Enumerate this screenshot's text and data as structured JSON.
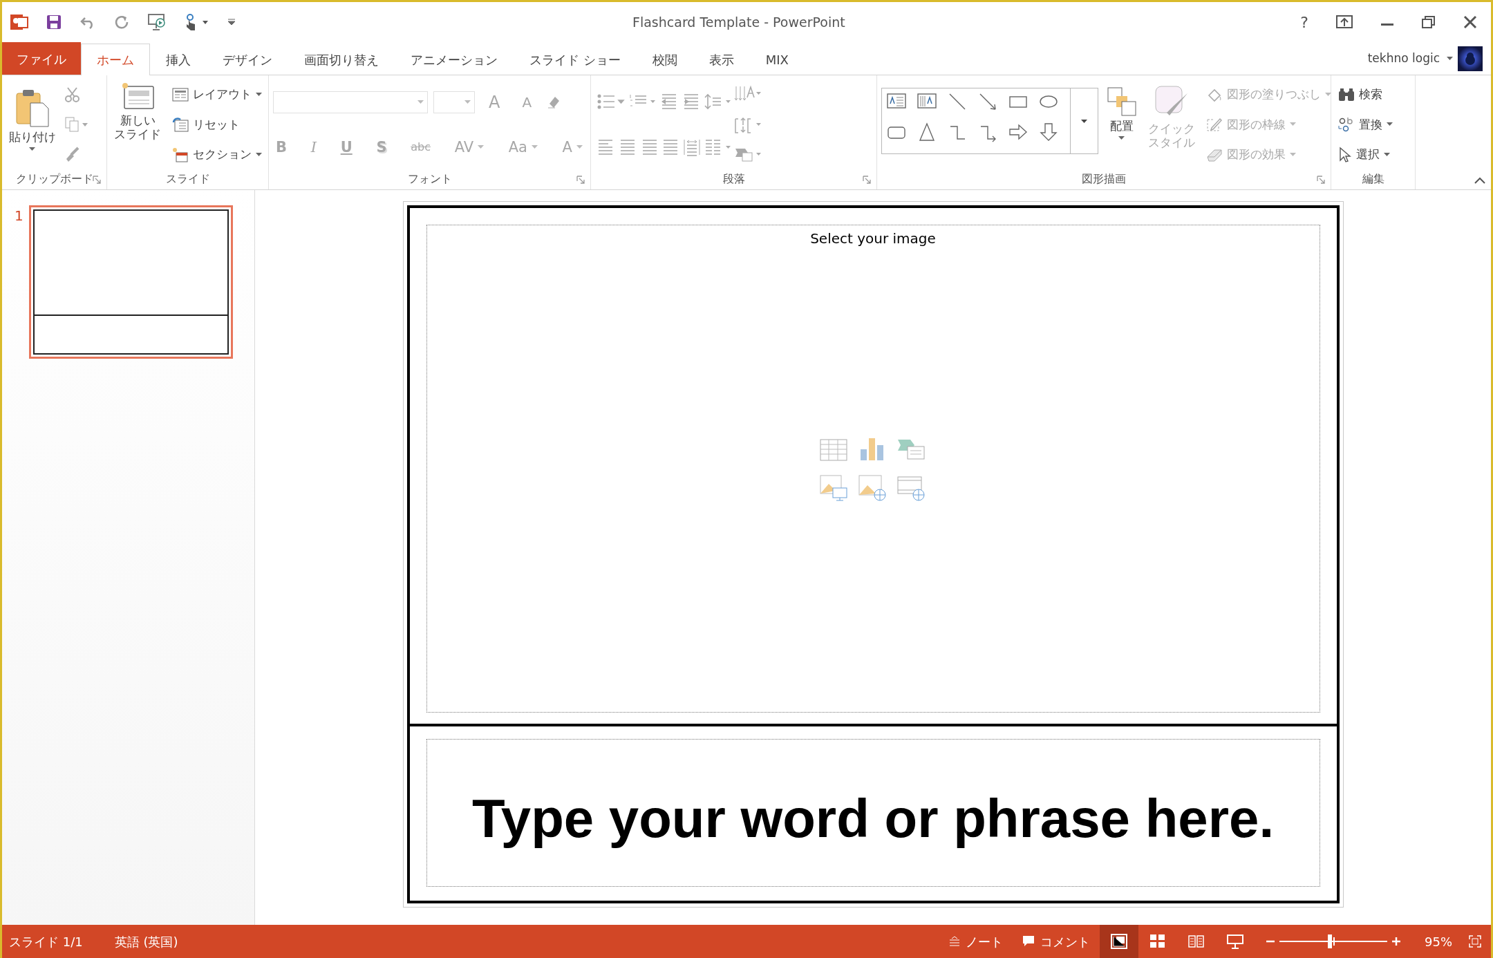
{
  "window": {
    "title": "Flashcard Template - PowerPoint",
    "help": "?"
  },
  "tabs": [
    {
      "label": "ファイル",
      "kind": "file",
      "selected": false
    },
    {
      "label": "ホーム",
      "kind": "tab",
      "selected": true
    },
    {
      "label": "挿入",
      "kind": "tab",
      "selected": false
    },
    {
      "label": "デザイン",
      "kind": "tab",
      "selected": false
    },
    {
      "label": "画面切り替え",
      "kind": "tab",
      "selected": false
    },
    {
      "label": "アニメーション",
      "kind": "tab",
      "selected": false
    },
    {
      "label": "スライド ショー",
      "kind": "tab",
      "selected": false
    },
    {
      "label": "校閲",
      "kind": "tab",
      "selected": false
    },
    {
      "label": "表示",
      "kind": "tab",
      "selected": false
    },
    {
      "label": "MIX",
      "kind": "tab",
      "selected": false
    }
  ],
  "account": {
    "name": "tekhno logic"
  },
  "ribbon": {
    "clipboard": {
      "title": "クリップボード",
      "paste": "貼り付け",
      "tools_disabled": true
    },
    "slides": {
      "title": "スライド",
      "new_slide": [
        "新しい",
        "スライド"
      ],
      "commands": [
        {
          "label": "レイアウト",
          "dropdown": true
        },
        {
          "label": "リセット",
          "dropdown": false
        },
        {
          "label": "セクション",
          "dropdown": true
        }
      ]
    },
    "font": {
      "title": "フォント",
      "disabled": true,
      "size_buttons": [
        "A",
        "A"
      ],
      "format_buttons": [
        "B",
        "I",
        "U",
        "S",
        "abc",
        "AV",
        "Aa",
        "A"
      ]
    },
    "paragraph": {
      "title": "段落",
      "disabled": true
    },
    "drawing": {
      "title": "図形描画",
      "arrange": "配置",
      "quick_styles": {
        "label": [
          "クイック",
          "スタイル"
        ],
        "disabled": true
      },
      "commands": [
        {
          "label": "図形の塗りつぶし",
          "disabled": true
        },
        {
          "label": "図形の枠線",
          "disabled": true
        },
        {
          "label": "図形の効果",
          "disabled": true
        }
      ]
    },
    "editing": {
      "title": "編集",
      "commands": [
        {
          "label": "検索",
          "dropdown": false
        },
        {
          "label": "置換",
          "dropdown": true
        },
        {
          "label": "選択",
          "dropdown": true
        }
      ]
    }
  },
  "slide_pane": {
    "thumbnails": [
      {
        "number": "1",
        "selected": true
      }
    ]
  },
  "slide": {
    "image_placeholder": "Select your image",
    "text": "Type your word or phrase here."
  },
  "status_bar": {
    "slide": "スライド 1/1",
    "language": "英語 (英国)",
    "notes": "ノート",
    "comments": "コメント",
    "views": [
      {
        "selected": true
      },
      {
        "selected": false
      },
      {
        "selected": false
      },
      {
        "selected": false
      }
    ],
    "zoom": {
      "level": 0.47,
      "reading": "95%"
    }
  }
}
